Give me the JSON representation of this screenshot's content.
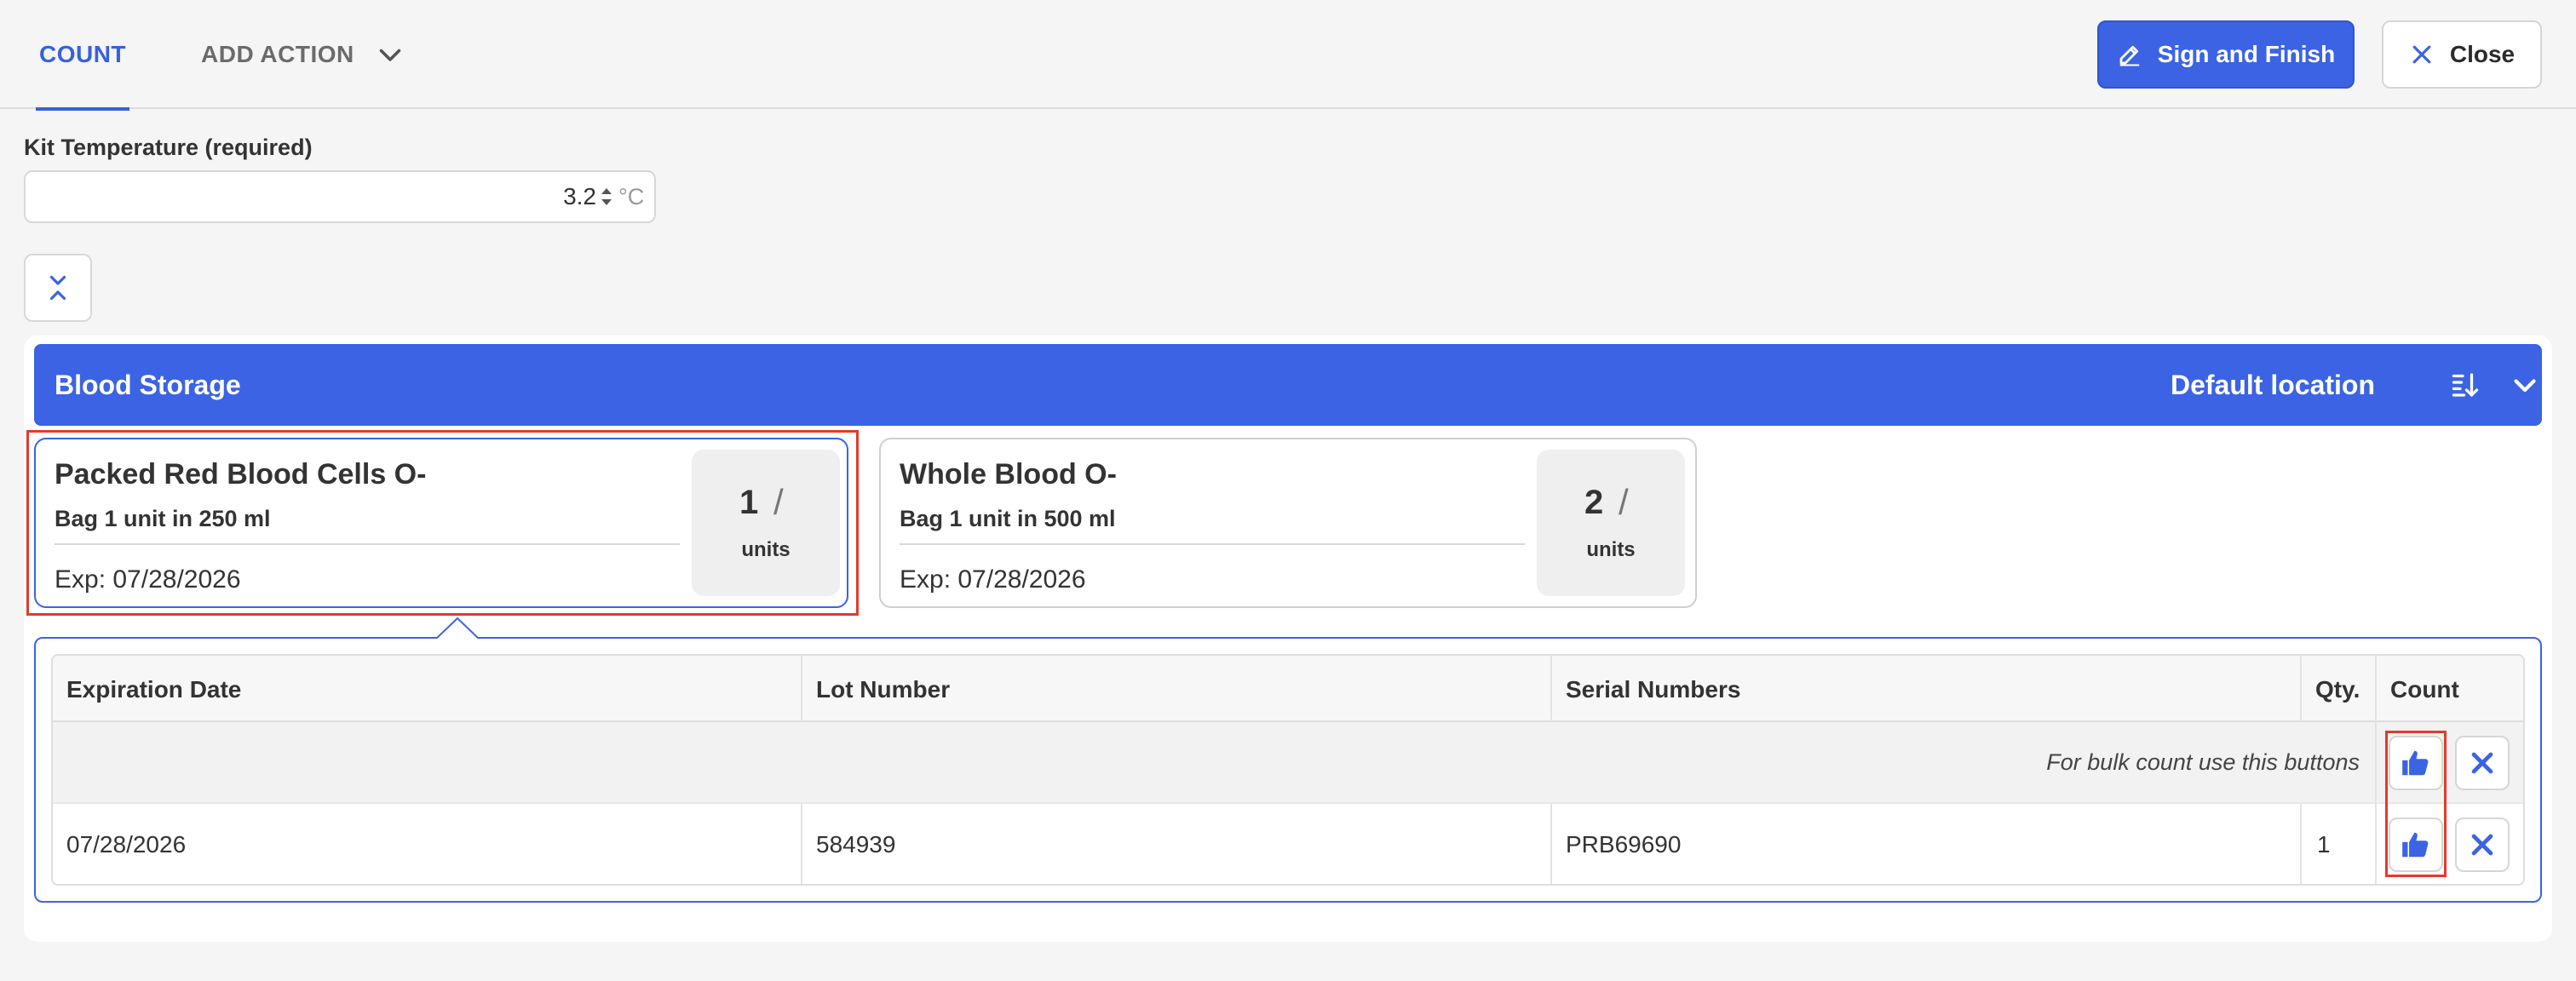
{
  "tabs": {
    "count": "COUNT",
    "add_action": "ADD ACTION"
  },
  "toolbar": {
    "sign_label": "Sign and Finish",
    "close_label": "Close"
  },
  "kit_temperature": {
    "label": "Kit Temperature (required)",
    "value": "3.2",
    "unit": "°C"
  },
  "storage": {
    "title": "Blood Storage",
    "location": "Default location"
  },
  "items": [
    {
      "name": "Packed Red Blood Cells O-",
      "packaging": "Bag 1 unit in 250 ml",
      "expiration": "Exp: 07/28/2026",
      "count": "1",
      "slash": "/",
      "unit_label": "units"
    },
    {
      "name": "Whole Blood O-",
      "packaging": "Bag 1 unit in 500 ml",
      "expiration": "Exp: 07/28/2026",
      "count": "2",
      "slash": "/",
      "unit_label": "units"
    }
  ],
  "table": {
    "headers": [
      "Expiration Date",
      "Lot Number",
      "Serial Numbers",
      "Qty.",
      "Count"
    ],
    "bulk_hint": "For bulk count use this buttons",
    "rows": [
      {
        "expiration": "07/28/2026",
        "lot": "584939",
        "serial": "PRB69690",
        "qty": "1"
      }
    ]
  },
  "colors": {
    "accent": "#3b63e4",
    "highlight": "#e33a2b"
  },
  "icons": [
    "chevron-down-icon",
    "pencil-icon",
    "close-x-icon",
    "collapse-icon",
    "sort-icon",
    "thumbs-up-icon",
    "x-mark-icon"
  ]
}
